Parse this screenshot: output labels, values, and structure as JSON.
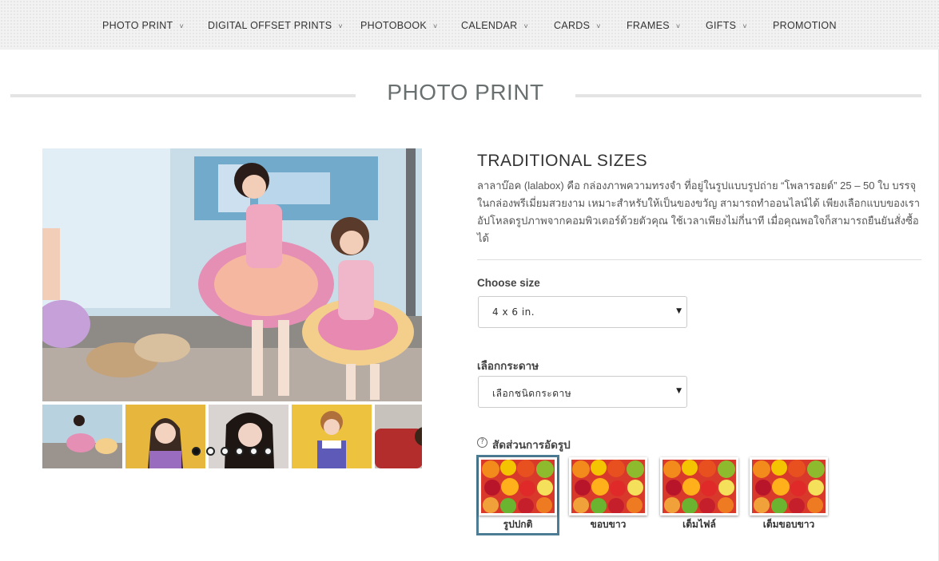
{
  "nav": {
    "items": [
      {
        "label": "PHOTO PRINT",
        "dropdown": true
      },
      {
        "label": "DIGITAL OFFSET PRINTS",
        "dropdown": true
      },
      {
        "label": "PHOTOBOOK",
        "dropdown": true
      },
      {
        "label": "CALENDAR",
        "dropdown": true
      },
      {
        "label": "CARDS",
        "dropdown": true
      },
      {
        "label": "FRAMES",
        "dropdown": true
      },
      {
        "label": "GIFTS",
        "dropdown": true
      },
      {
        "label": "PROMOTION",
        "dropdown": false
      }
    ],
    "chevron": "˅"
  },
  "page": {
    "title": "PHOTO PRINT"
  },
  "gallery": {
    "main_image": "concert-photo",
    "thumbnails": [
      "concert-photo",
      "girl-yellow-bg",
      "girl-dark-hair",
      "girl-twin-tails",
      "girl-red-sofa"
    ],
    "dots_count": 6,
    "active_dot": 0
  },
  "product": {
    "title": "TRADITIONAL SIZES",
    "description": "ลาลาบ๊อค (lalabox) คือ กล่องภาพความทรงจำ ที่อยู่ในรูปแบบรูปถ่าย “โพลารอยด์” 25 – 50 ใบ บรรจุในกล่องพรีเมี่ยมสวยงาม เหมาะสำหรับให้เป็นของขวัญ สามารถทำออนไลน์ได้ เพียงเลือกแบบของเรา อัปโหลดรูปภาพจากคอมพิวเตอร์ด้วยตัวคุณ ใช้เวลาเพียงไม่กี่นาที เมื่อคุณพอใจก็สามารถยืนยันสั่งซื้อได้"
  },
  "size_select": {
    "label": "Choose size",
    "value": "4 x 6 in.",
    "arrow": "▼"
  },
  "paper_select": {
    "label": "เลือกกระดาษ",
    "value": "เลือกชนิดกระดาษ",
    "arrow": "▼"
  },
  "crop": {
    "help_icon": "?",
    "label": "สัดส่วนการอัดรูป",
    "options": [
      {
        "label": "รูปปกติ",
        "selected": true
      },
      {
        "label": "ขอบขาว",
        "selected": false
      },
      {
        "label": "เต็มไฟล์",
        "selected": false
      },
      {
        "label": "เต็มขอบขาว",
        "selected": false
      }
    ]
  },
  "colors": {
    "accent": "#4d7d95",
    "title": "#6a7070",
    "nav_bg": "#f2f2f2"
  }
}
